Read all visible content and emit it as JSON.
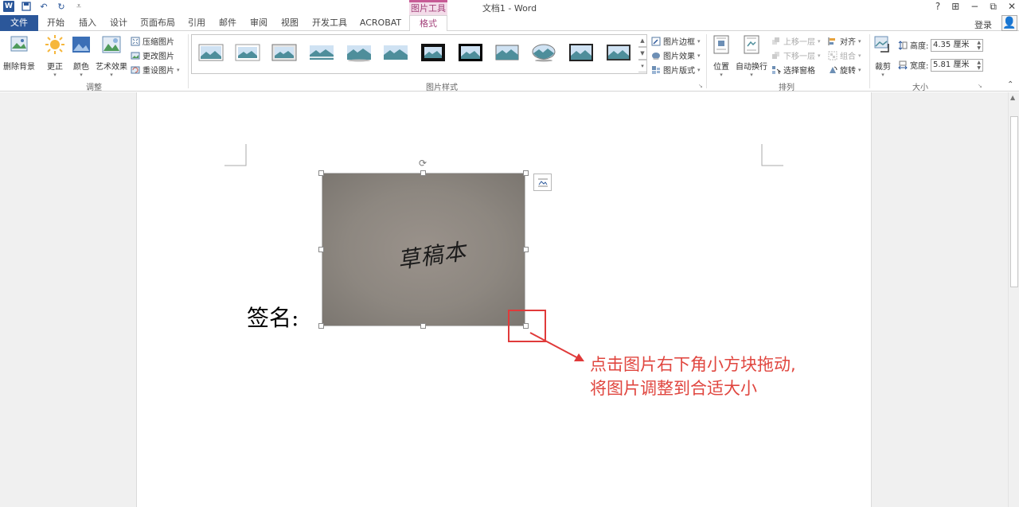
{
  "titlebar": {
    "document_title": "文档1 - Word",
    "context_group": "图片工具",
    "help": "?",
    "ribbon_options": "⊞",
    "minimize": "−",
    "restore": "⧉",
    "close": "✕"
  },
  "tabs": {
    "file": "文件",
    "items": [
      "开始",
      "插入",
      "设计",
      "页面布局",
      "引用",
      "邮件",
      "审阅",
      "视图",
      "开发工具",
      "ACROBAT"
    ],
    "active": "格式",
    "login": "登录"
  },
  "ribbon": {
    "adjust": {
      "remove_bg": "删除背景",
      "corrections": "更正",
      "color": "颜色",
      "artistic": "艺术效果",
      "compress": "压缩图片",
      "change": "更改图片",
      "reset": "重设图片",
      "label": "调整"
    },
    "styles": {
      "border": "图片边框",
      "effects": "图片效果",
      "layout": "图片版式",
      "label": "图片样式"
    },
    "arrange": {
      "position": "位置",
      "wrap": "自动换行",
      "forward": "上移一层",
      "backward": "下移一层",
      "selection_pane": "选择窗格",
      "align": "对齐",
      "group": "组合",
      "rotate": "旋转",
      "label": "排列"
    },
    "size": {
      "crop": "裁剪",
      "height_label": "高度:",
      "height_value": "4.35 厘米",
      "width_label": "宽度:",
      "width_value": "5.81 厘米",
      "label": "大小"
    }
  },
  "document": {
    "signature_label": "签名:",
    "picture_text": "草稿本",
    "annotation_line1": "点击图片右下角小方块拖动,",
    "annotation_line2": "将图片调整到合适大小"
  },
  "colors": {
    "word_blue": "#2b579a",
    "context_pink": "#a3417a",
    "annotation_red": "#e03a3a"
  }
}
